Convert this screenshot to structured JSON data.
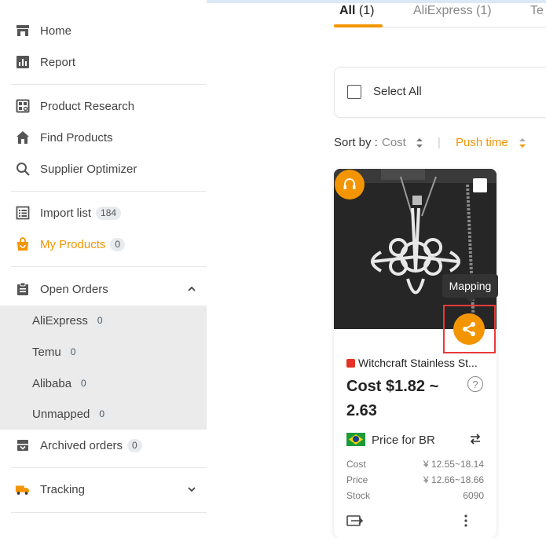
{
  "sidebar": {
    "items": [
      {
        "label": "Home",
        "icon": "store-icon"
      },
      {
        "label": "Report",
        "icon": "report-chart-icon"
      },
      {
        "label": "Product Research",
        "icon": "product-research-icon"
      },
      {
        "label": "Find Products",
        "icon": "house-icon"
      },
      {
        "label": "Supplier Optimizer",
        "icon": "search-icon"
      },
      {
        "label": "Import list",
        "count": "184",
        "icon": "list-icon"
      },
      {
        "label": "My Products",
        "count": "0",
        "icon": "bag-icon",
        "active": true
      },
      {
        "label": "Open Orders",
        "icon": "clipboard-icon",
        "expanded": true
      },
      {
        "label": "Archived orders",
        "count": "0",
        "icon": "archive-icon"
      },
      {
        "label": "Tracking",
        "icon": "truck-icon"
      }
    ],
    "open_orders_sub": [
      {
        "label": "AliExpress",
        "count": "0"
      },
      {
        "label": "Temu",
        "count": "0"
      },
      {
        "label": "Alibaba",
        "count": "0"
      },
      {
        "label": "Unmapped",
        "count": "0"
      }
    ]
  },
  "tabs": [
    {
      "label": "All",
      "count": "(1)",
      "active": true
    },
    {
      "label": "AliExpress",
      "count": "(1)"
    },
    {
      "label": "Te",
      "count": ""
    }
  ],
  "select_all_label": "Select All",
  "sort": {
    "label": "Sort by :",
    "cost": "Cost",
    "separator": "|",
    "push_time": "Push time"
  },
  "product": {
    "title": "Witchcraft Stainless St...",
    "cost": "Cost $1.82 ~ 2.63",
    "price_for": "Price for BR",
    "specs": [
      {
        "key": "Cost",
        "value": "¥ 12.55~18.14"
      },
      {
        "key": "Price",
        "value": "¥ 12.66~18.66"
      },
      {
        "key": "Stock",
        "value": "6090"
      }
    ],
    "mapping_tooltip": "Mapping"
  },
  "colors": {
    "accent": "#f39500",
    "highlight_box": "#e83a3a",
    "submenu_bg": "#ebebeb"
  }
}
